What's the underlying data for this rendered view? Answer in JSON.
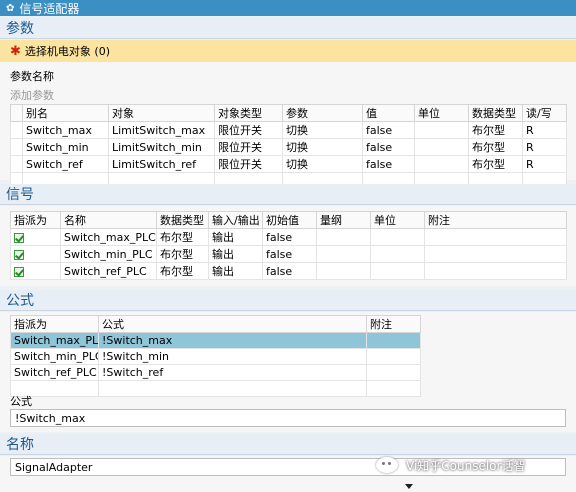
{
  "window": {
    "title": "信号适配器",
    "icon": "gear-icon"
  },
  "params": {
    "header": "参数",
    "select_label": "选择机电对象 (0)",
    "name_label": "参数名称",
    "add_placeholder": "添加参数",
    "columns": [
      "",
      "别名",
      "对象",
      "对象类型",
      "参数",
      "值",
      "单位",
      "数据类型",
      "读/写"
    ],
    "rows": [
      [
        "",
        "Switch_max",
        "LimitSwitch_max",
        "限位开关",
        "切换",
        "false",
        "",
        "布尔型",
        "R"
      ],
      [
        "",
        "Switch_min",
        "LimitSwitch_min",
        "限位开关",
        "切换",
        "false",
        "",
        "布尔型",
        "R"
      ],
      [
        "",
        "Switch_ref",
        "LimitSwitch_ref",
        "限位开关",
        "切换",
        "false",
        "",
        "布尔型",
        "R"
      ]
    ]
  },
  "signals": {
    "header": "信号",
    "columns": [
      "指派为",
      "名称",
      "数据类型",
      "输入/输出",
      "初始值",
      "量纲",
      "单位",
      "附注"
    ],
    "rows": [
      {
        "checked": true,
        "name": "Switch_max_PLC",
        "type": "布尔型",
        "io": "输出",
        "init": "false"
      },
      {
        "checked": true,
        "name": "Switch_min_PLC",
        "type": "布尔型",
        "io": "输出",
        "init": "false"
      },
      {
        "checked": true,
        "name": "Switch_ref_PLC",
        "type": "布尔型",
        "io": "输出",
        "init": "false"
      }
    ]
  },
  "formula": {
    "header": "公式",
    "columns": [
      "指派为",
      "公式",
      "附注"
    ],
    "rows": [
      [
        "Switch_max_PLC",
        "!Switch_max",
        ""
      ],
      [
        "Switch_min_PLC",
        "!Switch_min",
        ""
      ],
      [
        "Switch_ref_PLC",
        "!Switch_ref",
        ""
      ]
    ],
    "selected_row": 0,
    "field_label": "公式",
    "field_value": "!Switch_max"
  },
  "name": {
    "header": "名称",
    "value": "SignalAdapter"
  },
  "watermark": "Vi知乎Counselor话智"
}
